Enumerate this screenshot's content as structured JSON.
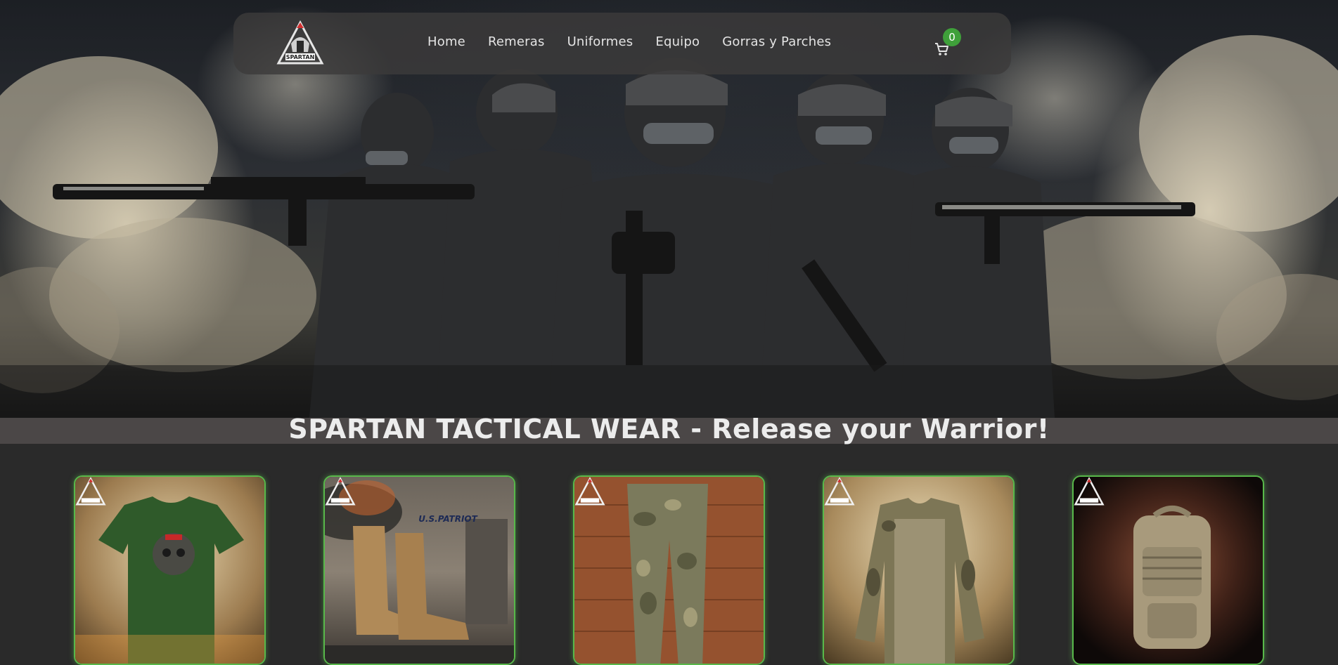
{
  "brand": {
    "logo_text": "SPARTAN"
  },
  "nav": {
    "items": [
      {
        "label": "Home"
      },
      {
        "label": "Remeras"
      },
      {
        "label": "Uniformes"
      },
      {
        "label": "Equipo"
      },
      {
        "label": "Gorras y Parches"
      }
    ],
    "cart_count": "0"
  },
  "hero": {
    "tagline": "SPARTAN TACTICAL WEAR - Release your Warrior!"
  },
  "products": [
    {
      "name": "tshirt",
      "brand_text": ""
    },
    {
      "name": "boots",
      "brand_text": "U.S.PATRIOT"
    },
    {
      "name": "pants",
      "brand_text": ""
    },
    {
      "name": "combat-shirt",
      "brand_text": ""
    },
    {
      "name": "backpack",
      "brand_text": ""
    }
  ],
  "colors": {
    "accent_green": "#58b84a",
    "badge_green": "#3fa03a",
    "page_bg": "#2a2a2a"
  }
}
